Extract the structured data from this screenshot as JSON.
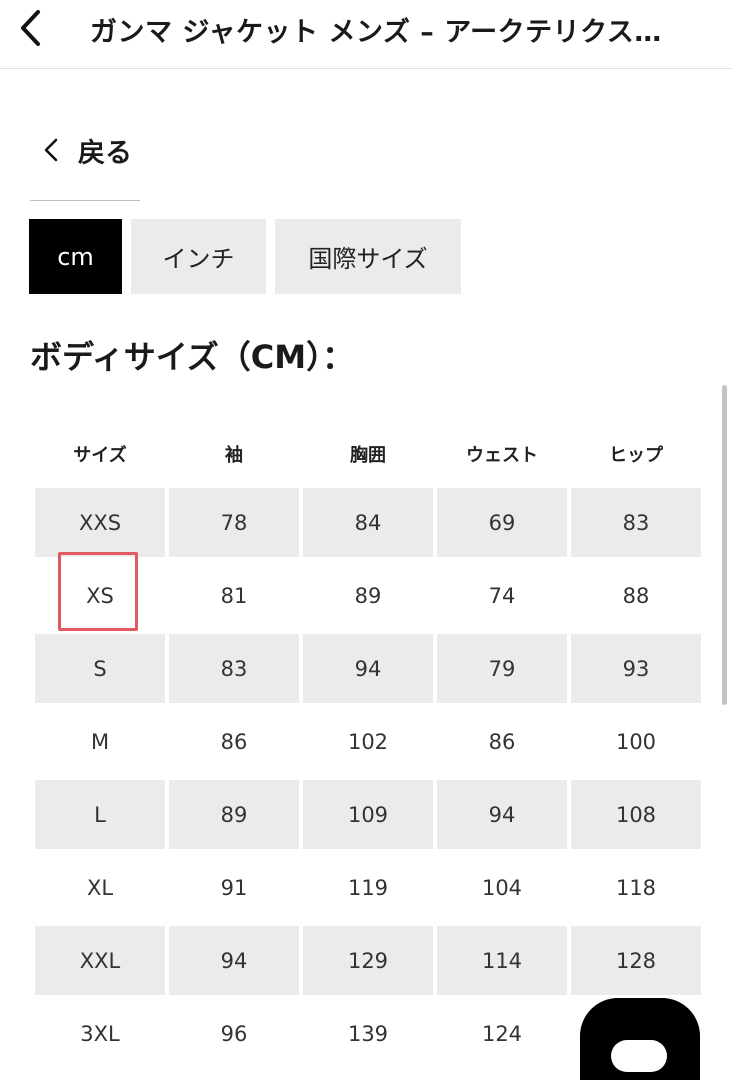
{
  "header": {
    "title": "ガンマ ジャケット メンズ – アークテリクス…",
    "back_icon": "chevron-left-icon"
  },
  "back_link": {
    "label": "戻る",
    "icon": "chevron-left-icon"
  },
  "unit_tabs": [
    {
      "label": "cm",
      "active": true
    },
    {
      "label": "インチ",
      "active": false
    },
    {
      "label": "国際サイズ",
      "active": false
    }
  ],
  "section_title": "ボディサイズ（CM）：",
  "table": {
    "headers": [
      "サイズ",
      "袖",
      "胸囲",
      "ウェスト",
      "ヒップ"
    ],
    "rows": [
      [
        "XXS",
        "78",
        "84",
        "69",
        "83"
      ],
      [
        "XS",
        "81",
        "89",
        "74",
        "88"
      ],
      [
        "S",
        "83",
        "94",
        "79",
        "93"
      ],
      [
        "M",
        "86",
        "102",
        "86",
        "100"
      ],
      [
        "L",
        "89",
        "109",
        "94",
        "108"
      ],
      [
        "XL",
        "91",
        "119",
        "104",
        "118"
      ],
      [
        "XXL",
        "94",
        "129",
        "114",
        "128"
      ],
      [
        "3XL",
        "96",
        "139",
        "124",
        ""
      ]
    ],
    "highlighted_size": "XS",
    "highlight_color": "#e05a5f",
    "shaded_color": "#ebebeb"
  },
  "colors": {
    "active_tab": "#000000",
    "inactive_tab": "#ebebeb"
  },
  "chat_widget": {
    "icon": "chat-bubble-icon"
  }
}
